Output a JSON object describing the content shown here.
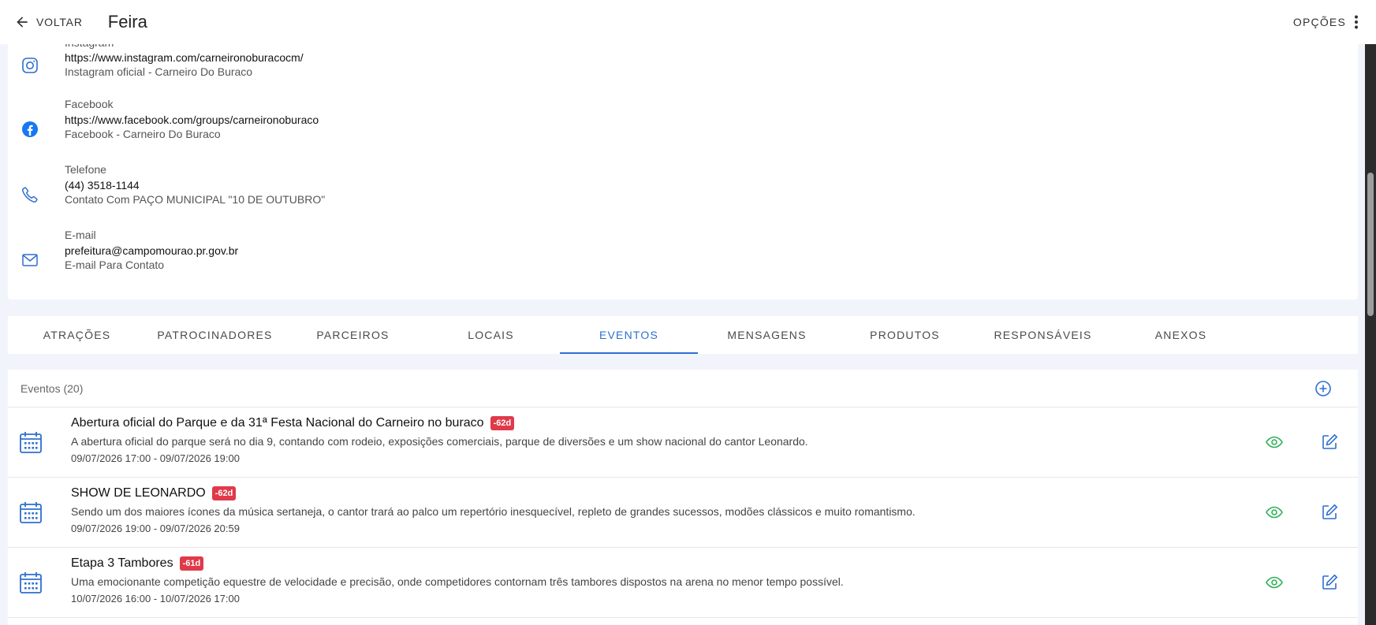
{
  "topbar": {
    "back_label": "VOLTAR",
    "title": "Feira",
    "options_label": "OPÇÕES"
  },
  "contacts": [
    {
      "icon": "instagram-icon",
      "label": "Instagram",
      "value": "https://www.instagram.com/carneironoburacocm/",
      "desc": "Instagram oficial - Carneiro Do Buraco"
    },
    {
      "icon": "facebook-icon",
      "label": "Facebook",
      "value": "https://www.facebook.com/groups/carneironoburaco",
      "desc": "Facebook - Carneiro Do Buraco"
    },
    {
      "icon": "phone-icon",
      "label": "Telefone",
      "value": "(44) 3518-1144",
      "desc": "Contato Com PAÇO MUNICIPAL \"10 DE OUTUBRO\""
    },
    {
      "icon": "mail-icon",
      "label": "E-mail",
      "value": "prefeitura@campomourao.pr.gov.br",
      "desc": "E-mail Para Contato"
    }
  ],
  "tabs": [
    {
      "label": "ATRAÇÕES",
      "active": false
    },
    {
      "label": "PATROCINADORES",
      "active": false
    },
    {
      "label": "PARCEIROS",
      "active": false
    },
    {
      "label": "LOCAIS",
      "active": false
    },
    {
      "label": "EVENTOS",
      "active": true
    },
    {
      "label": "MENSAGENS",
      "active": false
    },
    {
      "label": "PRODUTOS",
      "active": false
    },
    {
      "label": "RESPONSÁVEIS",
      "active": false
    },
    {
      "label": "ANEXOS",
      "active": false
    }
  ],
  "events": {
    "count_label": "Eventos (20)",
    "items": [
      {
        "title": "Abertura oficial do Parque e da 31ª Festa Nacional do Carneiro no buraco",
        "badge": "-62d",
        "desc": "A abertura oficial do parque será no dia 9, contando com rodeio, exposições comerciais, parque de diversões e um show nacional do cantor Leonardo.",
        "dates": "09/07/2026 17:00 - 09/07/2026 19:00"
      },
      {
        "title": "SHOW DE LEONARDO",
        "badge": "-62d",
        "desc": "Sendo um dos maiores ícones da música sertaneja, o cantor trará ao palco um repertório inesquecível, repleto de grandes sucessos, modões clássicos e muito romantismo.",
        "dates": "09/07/2026 19:00 - 09/07/2026 20:59"
      },
      {
        "title": "Etapa 3 Tambores",
        "badge": "-61d",
        "desc": "Uma emocionante competição equestre de velocidade e precisão, onde competidores contornam três tambores dispostos na arena no menor tempo possível.",
        "dates": "10/07/2026 16:00 - 10/07/2026 17:00"
      }
    ]
  },
  "colors": {
    "accent": "#2f6fcf",
    "badge": "#e03a4a",
    "view_icon": "#2fb05a",
    "edit_icon": "#2f6fcf",
    "facebook": "#1877f2"
  }
}
